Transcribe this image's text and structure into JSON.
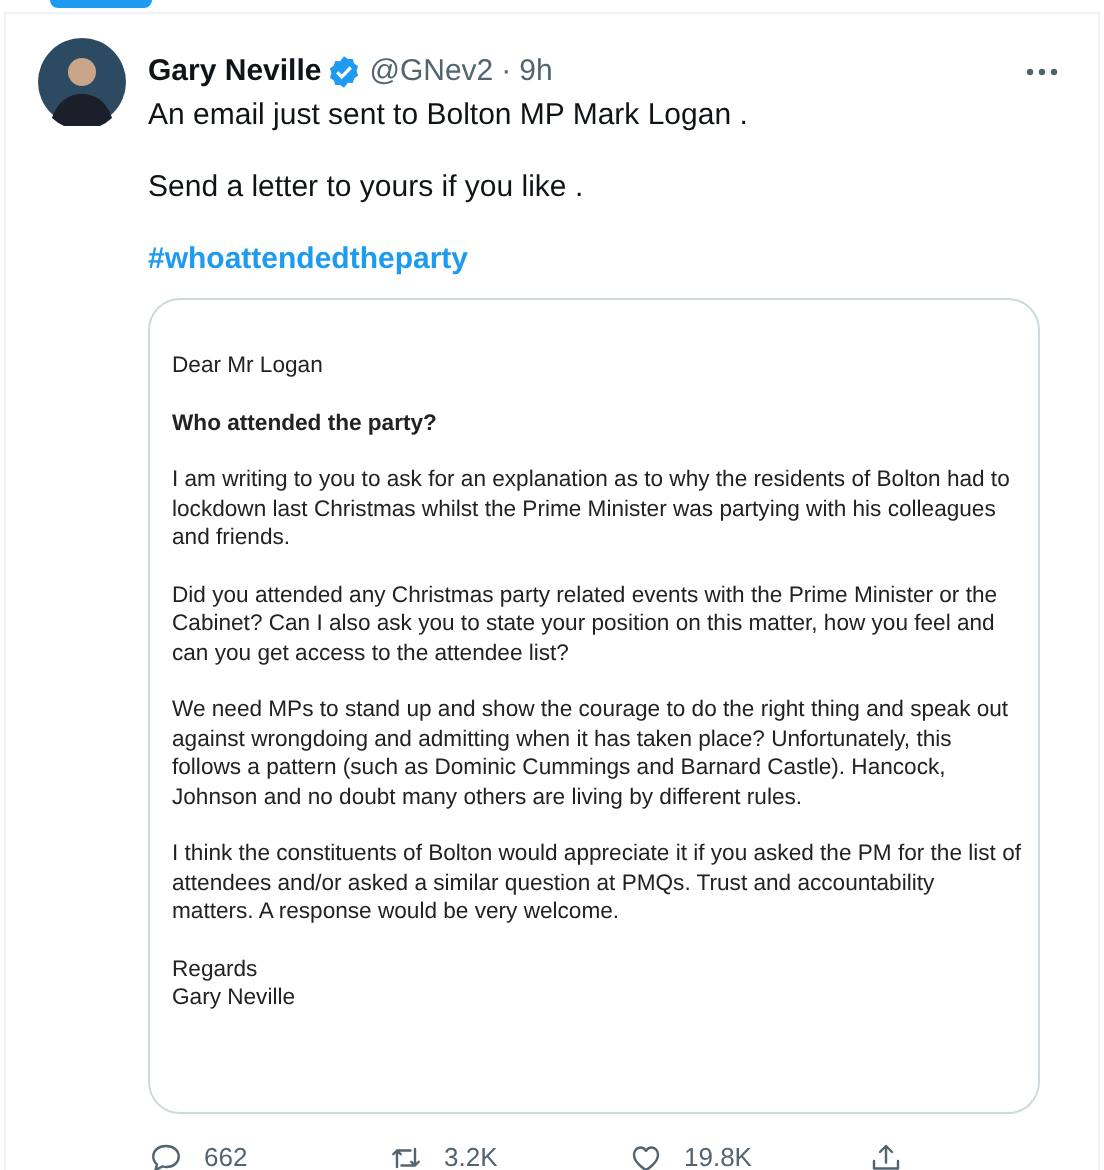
{
  "tweet": {
    "author": "Gary Neville",
    "verified": true,
    "handle": "@GNev2",
    "separator": "·",
    "time": "9h",
    "paragraphs": [
      "An email just sent to Bolton MP Mark Logan .",
      "Send a letter to yours if you like ."
    ],
    "hashtag": "#whoattendedtheparty",
    "letter": {
      "greeting": "Dear Mr Logan",
      "heading": "Who attended the party?",
      "paragraphs": [
        "I am writing to you to ask for an explanation as to why the residents of Bolton had to lockdown last Christmas whilst the Prime Minister was partying with his colleagues and friends.",
        "Did you attended any Christmas party related events with the Prime Minister or the Cabinet? Can I also ask you to state your position on this matter, how you feel and can you get access to the attendee list?",
        "We need MPs to stand up and show the courage to do the right thing and speak out against wrongdoing and admitting when it has taken place? Unfortunately, this follows a pattern (such as Dominic Cummings and Barnard Castle). Hancock, Johnson and no doubt many others are living by different rules.",
        "I think the constituents of Bolton would appreciate it if you asked the PM for the list of attendees and/or asked a similar question at PMQs. Trust and accountability matters. A response would be very welcome."
      ],
      "closing": "Regards",
      "signature": "Gary Neville"
    },
    "actions": [
      {
        "kind": "reply",
        "count": "662"
      },
      {
        "kind": "retweet",
        "count": "3.2K"
      },
      {
        "kind": "like",
        "count": "19.8K"
      },
      {
        "kind": "share"
      }
    ]
  }
}
